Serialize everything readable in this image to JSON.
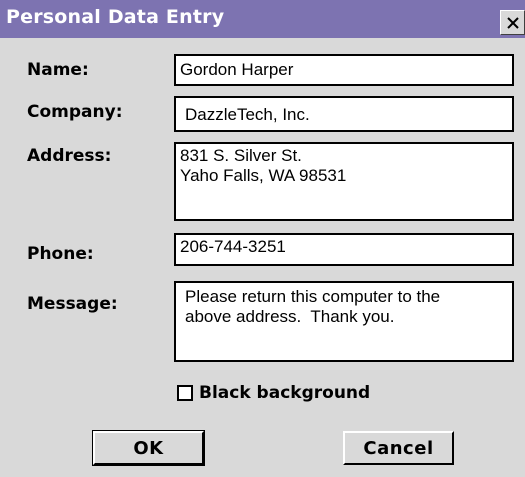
{
  "window": {
    "title": "Personal Data Entry",
    "close_icon": "close-icon"
  },
  "form": {
    "name_label": "Name:",
    "name_value": "Gordon Harper",
    "company_label": "Company:",
    "company_value": "DazzleTech, Inc.",
    "address_label": "Address:",
    "address_value": "831 S. Silver St.\nYaho Falls, WA 98531",
    "phone_label": "Phone:",
    "phone_value": "206-744-3251",
    "message_label": "Message:",
    "message_value": "Please return this computer to the\nabove address.  Thank you.",
    "black_background_label": "Black background",
    "black_background_checked": false
  },
  "buttons": {
    "ok_label": "OK",
    "cancel_label": "Cancel"
  },
  "colors": {
    "titlebar": "#7d73b1",
    "dialog_bg": "#d9d9d9",
    "field_bg": "#ffffff"
  }
}
